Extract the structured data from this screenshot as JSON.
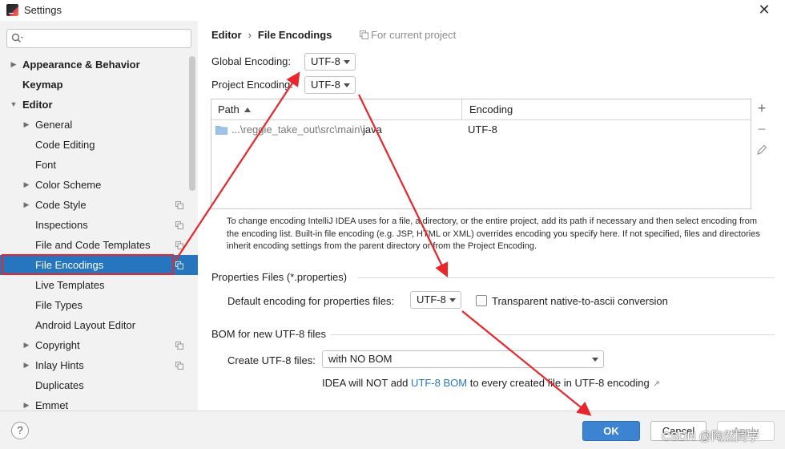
{
  "window": {
    "title": "Settings",
    "close_icon": "close-icon"
  },
  "sidebar": {
    "search": {
      "value": "",
      "placeholder": ""
    },
    "items": [
      {
        "label": "Appearance & Behavior",
        "bold": true,
        "level": 0,
        "arrow": "right"
      },
      {
        "label": "Keymap",
        "bold": true,
        "level": 0,
        "arrow": ""
      },
      {
        "label": "Editor",
        "bold": true,
        "level": 0,
        "arrow": "down"
      },
      {
        "label": "General",
        "bold": false,
        "level": 1,
        "arrow": "right"
      },
      {
        "label": "Code Editing",
        "bold": false,
        "level": 1,
        "arrow": ""
      },
      {
        "label": "Font",
        "bold": false,
        "level": 1,
        "arrow": ""
      },
      {
        "label": "Color Scheme",
        "bold": false,
        "level": 1,
        "arrow": "right"
      },
      {
        "label": "Code Style",
        "bold": false,
        "level": 1,
        "arrow": "right",
        "copy": true
      },
      {
        "label": "Inspections",
        "bold": false,
        "level": 1,
        "arrow": "",
        "copy": true
      },
      {
        "label": "File and Code Templates",
        "bold": false,
        "level": 1,
        "arrow": "",
        "copy": true
      },
      {
        "label": "File Encodings",
        "bold": false,
        "level": 1,
        "arrow": "",
        "copy": true,
        "selected": true
      },
      {
        "label": "Live Templates",
        "bold": false,
        "level": 1,
        "arrow": ""
      },
      {
        "label": "File Types",
        "bold": false,
        "level": 1,
        "arrow": ""
      },
      {
        "label": "Android Layout Editor",
        "bold": false,
        "level": 1,
        "arrow": ""
      },
      {
        "label": "Copyright",
        "bold": false,
        "level": 1,
        "arrow": "right",
        "copy": true
      },
      {
        "label": "Inlay Hints",
        "bold": false,
        "level": 1,
        "arrow": "right",
        "copy": true
      },
      {
        "label": "Duplicates",
        "bold": false,
        "level": 1,
        "arrow": ""
      },
      {
        "label": "Emmet",
        "bold": false,
        "level": 1,
        "arrow": "right"
      }
    ]
  },
  "breadcrumb": {
    "parent": "Editor",
    "separator": "›",
    "current": "File Encodings"
  },
  "scope_hint": "For current project",
  "global_encoding": {
    "label": "Global Encoding:",
    "value": "UTF-8"
  },
  "project_encoding": {
    "label": "Project Encoding:",
    "value": "UTF-8"
  },
  "table": {
    "columns": [
      "Path",
      "Encoding"
    ],
    "rows": [
      {
        "path_prefix": "...\\regg",
        "path_hidden": "ie_take_out\\src\\main\\",
        "path_tail": "java",
        "encoding": "UTF-8"
      }
    ],
    "tools": {
      "add": "+",
      "remove": "−"
    }
  },
  "help_text": "To change encoding IntelliJ IDEA uses for a file, a directory, or the entire project, add its path if necessary and then select encoding from the encoding list. Built-in file encoding (e.g. JSP, HTML or XML) overrides encoding you specify here. If not specified, files and directories inherit encoding settings from the parent directory or from the Project Encoding.",
  "properties": {
    "section_title": "Properties Files (*.properties)",
    "default_label": "Default encoding for properties files:",
    "default_value": "UTF-8",
    "checkbox_label": "Transparent native-to-ascii conversion",
    "checkbox_checked": false
  },
  "bom": {
    "section_title": "BOM for new UTF-8 files",
    "create_label": "Create UTF-8 files:",
    "create_value": "with NO BOM",
    "info_prefix": "IDEA will NOT add ",
    "info_link": "UTF-8 BOM",
    "info_suffix": " to every created file in UTF-8 encoding",
    "info_ext": "↗"
  },
  "footer": {
    "help": "?",
    "ok": "OK",
    "cancel": "Cancel",
    "apply": "Apply"
  },
  "watermark": "CSDN @陶然同学",
  "colors": {
    "selection": "#2675bf",
    "annotation": "#e8262b",
    "ok_button": "#3c84d1",
    "link": "#2675bf"
  }
}
